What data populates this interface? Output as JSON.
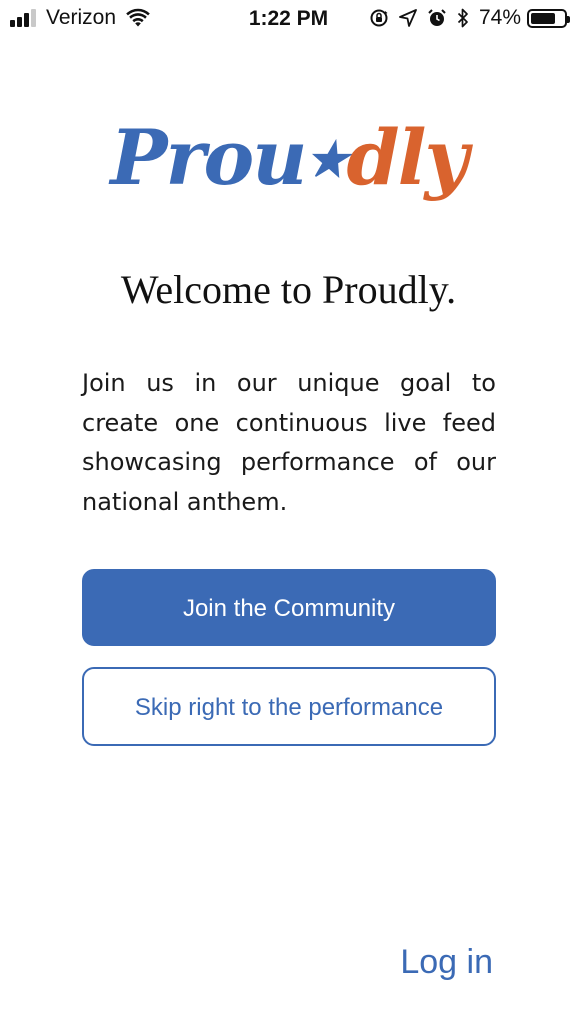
{
  "status_bar": {
    "carrier": "Verizon",
    "time": "1:22 PM",
    "battery_percent": "74%",
    "battery_level": 0.74,
    "signal_bars_filled": 3,
    "signal_bars_total": 4,
    "icons": [
      "wifi-icon",
      "rotation-lock-icon",
      "location-arrow-icon",
      "alarm-icon",
      "bluetooth-icon",
      "battery-icon"
    ]
  },
  "logo": {
    "part1": "Prou",
    "star": "★",
    "part2": "dly"
  },
  "welcome": {
    "headline": "Welcome to Proudly.",
    "intro": "Join us in our unique goal to create one continuous live feed showcasing performance of our national anthem."
  },
  "actions": {
    "join_label": "Join the Community",
    "skip_label": "Skip right to the performance",
    "login_label": "Log in"
  },
  "colors": {
    "brand_blue": "#3b6ab5",
    "brand_orange": "#d9632e"
  }
}
